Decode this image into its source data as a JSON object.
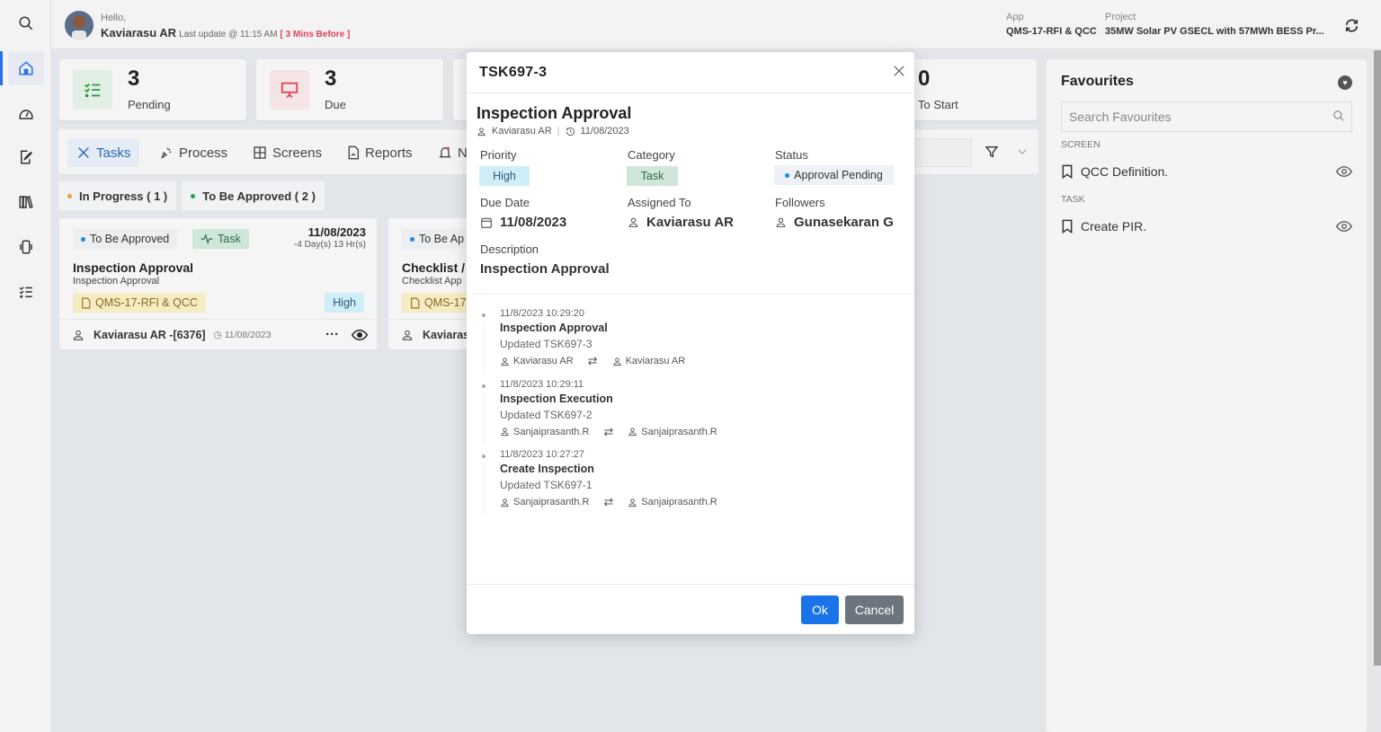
{
  "header": {
    "greeting": "Hello,",
    "user_name": "Kaviarasu AR",
    "last_update": "Last update @ 11:15 AM",
    "last_update_ago": "[ 3 Mins Before ]",
    "app_label": "App",
    "app_value": "QMS-17-RFI & QCC",
    "project_label": "Project",
    "project_value": "35MW Solar PV GSECL with 57MWh BESS Pr..."
  },
  "sidebar": {
    "items": [
      {
        "icon": "search-icon"
      },
      {
        "icon": "home-icon",
        "active": true
      },
      {
        "icon": "dashboard-icon"
      },
      {
        "icon": "edit-document-icon"
      },
      {
        "icon": "library-icon"
      },
      {
        "icon": "device-icon"
      },
      {
        "icon": "checklist-icon"
      }
    ]
  },
  "stats": [
    {
      "value": "3",
      "label": "Pending",
      "icon": "checklist-icon",
      "color": "#2e9e48"
    },
    {
      "value": "3",
      "label": "Due",
      "icon": "presentation-icon",
      "color": "#e0435a"
    },
    {
      "value": "0",
      "label": "To Start"
    }
  ],
  "tabs": [
    {
      "label": "Tasks",
      "icon": "tools-icon",
      "active": true
    },
    {
      "label": "Process",
      "icon": "process-icon"
    },
    {
      "label": "Screens",
      "icon": "grid-icon"
    },
    {
      "label": "Reports",
      "icon": "report-icon"
    },
    {
      "label": "N",
      "icon": "bell-icon"
    }
  ],
  "status_tabs": [
    {
      "label": "In Progress ( 1 )",
      "dot_color": "#f0a030"
    },
    {
      "label": "To Be Approved ( 2 )",
      "dot_color": "#2e9e48"
    }
  ],
  "cards": [
    {
      "status": "To Be Approved",
      "category": "Task",
      "due_date": "11/08/2023",
      "remaining": "-4 Day(s) 13 Hr(s)",
      "title": "Inspection Approval",
      "subtitle": "Inspection Approval",
      "app": "QMS-17-RFI & QCC",
      "priority": "High",
      "assignee": "Kaviarasu AR -[6376]",
      "created": "11/08/2023"
    },
    {
      "status": "To Be Ap",
      "title": "Checklist /",
      "subtitle": "Checklist App",
      "app": "QMS-17-",
      "assignee": "Kaviaras"
    }
  ],
  "favourites": {
    "title": "Favourites",
    "search_placeholder": "Search Favourites",
    "sections": [
      {
        "name": "SCREEN",
        "items": [
          "QCC Definition."
        ]
      },
      {
        "name": "TASK",
        "items": [
          "Create PIR."
        ]
      }
    ]
  },
  "modal": {
    "id": "TSK697-3",
    "title": "Inspection Approval",
    "created_by": "Kaviarasu AR",
    "created_on": "11/08/2023",
    "priority_label": "Priority",
    "priority": "High",
    "category_label": "Category",
    "category": "Task",
    "status_label": "Status",
    "status": "Approval Pending",
    "due_date_label": "Due Date",
    "due_date": "11/08/2023",
    "assigned_to_label": "Assigned To",
    "assigned_to": "Kaviarasu AR",
    "followers_label": "Followers",
    "followers": "Gunasekaran G",
    "description_label": "Description",
    "description": "Inspection Approval",
    "history": [
      {
        "time": "11/8/2023 10:29:20",
        "title": "Inspection Approval",
        "update": "Updated TSK697-3",
        "from": "Kaviarasu AR",
        "to": "Kaviarasu AR"
      },
      {
        "time": "11/8/2023 10:29:11",
        "title": "Inspection Execution",
        "update": "Updated TSK697-2",
        "from": "Sanjaiprasanth.R",
        "to": "Sanjaiprasanth.R"
      },
      {
        "time": "11/8/2023 10:27:27",
        "title": "Create Inspection",
        "update": "Updated TSK697-1",
        "from": "Sanjaiprasanth.R",
        "to": "Sanjaiprasanth.R"
      }
    ],
    "ok_label": "Ok",
    "cancel_label": "Cancel"
  },
  "colors": {
    "primary": "#1a73e8",
    "cancel": "#6c757d",
    "accent_red": "#e0435a",
    "priority_high_bg": "#cfeef7",
    "category_task_bg": "#cfe6d8",
    "app_chip_bg": "#f6ecc3"
  }
}
